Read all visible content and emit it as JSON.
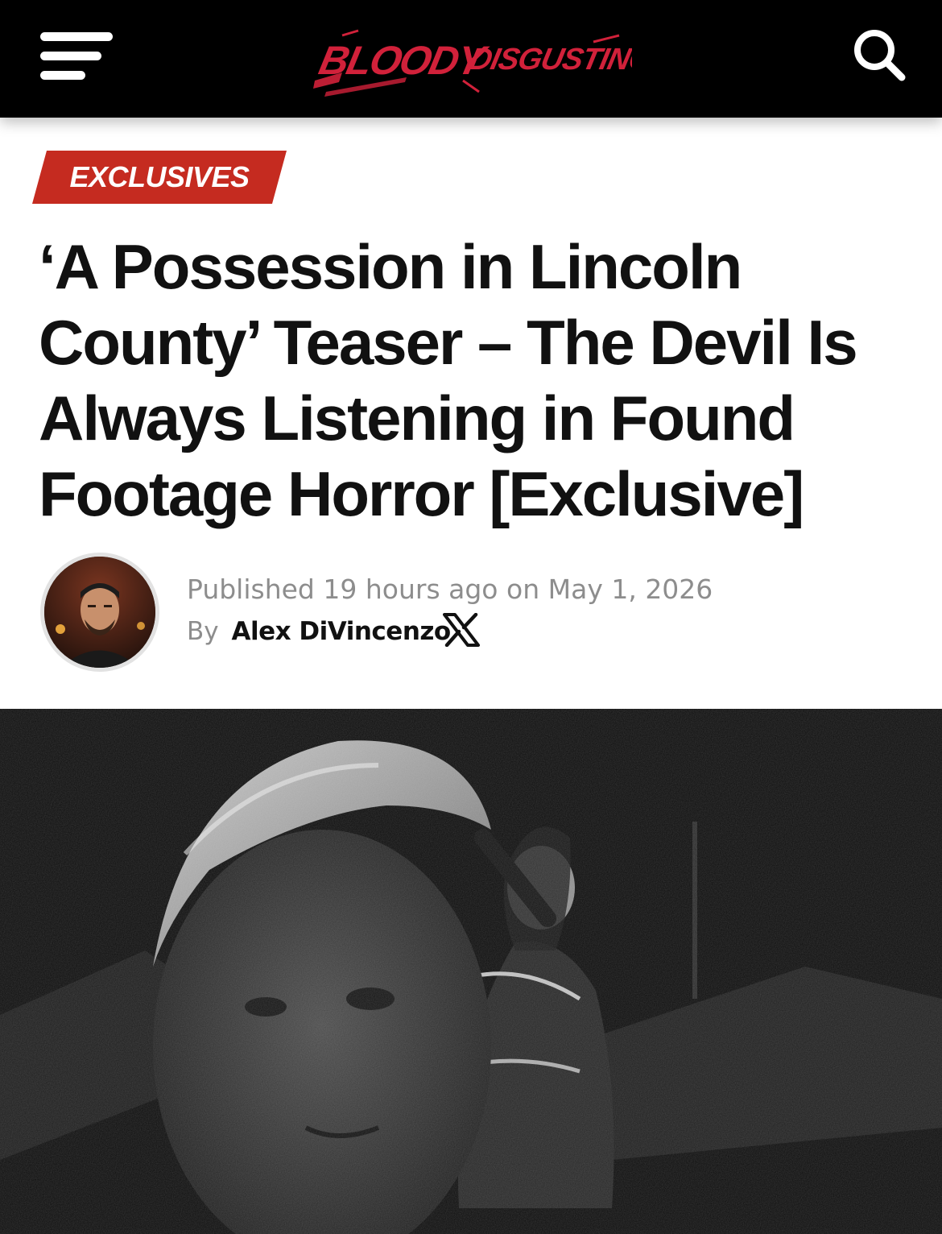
{
  "header": {
    "logo_text": "BLOODY DISGUSTING",
    "menu_icon": "hamburger-menu-icon",
    "search_icon": "search-icon",
    "brand_color": "#d1213a"
  },
  "article": {
    "category": "EXCLUSIVES",
    "category_color": "#c52b20",
    "headline": "‘A Possession in Lincoln County’ Teaser – The Devil Is Always Listening in Found Footage Horror [Exclusive]",
    "published_label": "Published",
    "published_relative": "19 hours ago",
    "published_on": "on",
    "published_date": "May 1, 2026",
    "by_label": "By",
    "author": "Alex DiVincenzo",
    "author_social_icon": "x-logo-icon"
  }
}
